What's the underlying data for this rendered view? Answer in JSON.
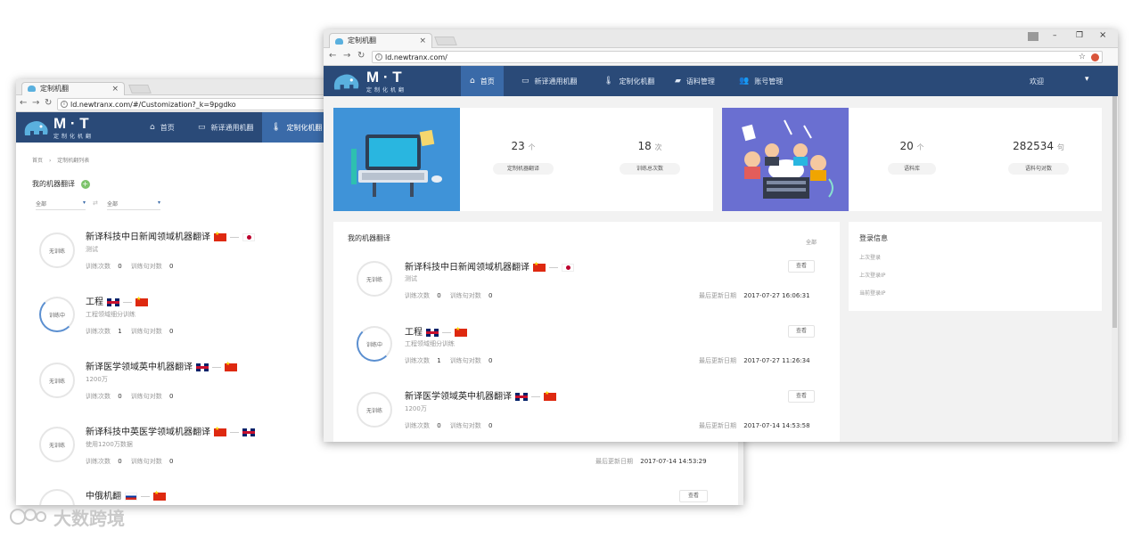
{
  "tab_title": "定制机翻",
  "back": {
    "url": "ld.newtranx.com/#/Customization?_k=9pgdko",
    "breadcrumb": [
      "首页",
      "定制机翻列表"
    ],
    "section_title": "我的机器翻译",
    "filters": [
      "全部",
      "全部"
    ],
    "items": [
      {
        "title": "新译科技中日新闻领域机器翻译",
        "desc": "测试",
        "status": "无训练",
        "train_count_label": "训练次数",
        "train_count": "0",
        "pairs_label": "训练句对数",
        "pairs": "0",
        "flags": [
          "cn",
          "jp"
        ]
      },
      {
        "title": "工程",
        "desc": "工程领域细分训练",
        "status": "训练中",
        "train_count_label": "训练次数",
        "train_count": "1",
        "pairs_label": "训练句对数",
        "pairs": "0",
        "flags": [
          "gb",
          "cn"
        ]
      },
      {
        "title": "新译医学领域英中机器翻译",
        "desc": "1200万",
        "status": "无训练",
        "train_count_label": "训练次数",
        "train_count": "0",
        "pairs_label": "训练句对数",
        "pairs": "0",
        "flags": [
          "gb",
          "cn"
        ]
      },
      {
        "title": "新译科技中英医学领域机器翻译",
        "desc": "使用1200万数据",
        "status": "无训练",
        "train_count_label": "训练次数",
        "train_count": "0",
        "pairs_label": "训练句对数",
        "pairs": "0",
        "flags": [
          "cn",
          "gb"
        ],
        "updated_label": "最后更新日期",
        "updated": "2017-07-14 14:53:29"
      },
      {
        "title": "中俄机翻",
        "flags": [
          "ru",
          "cn"
        ],
        "view": "查看"
      }
    ]
  },
  "front": {
    "url": "ld.newtranx.com/",
    "logo": "M · T",
    "logo_sub": "定制化机翻",
    "nav": [
      {
        "label": "首页",
        "icon": "home-icon",
        "glyph": "⌂"
      },
      {
        "label": "新译通用机翻",
        "icon": "laptop-icon",
        "glyph": "▭"
      },
      {
        "label": "定制化机翻",
        "icon": "thermometer-icon",
        "glyph": "🌡"
      },
      {
        "label": "语料管理",
        "icon": "folder-icon",
        "glyph": "▰"
      },
      {
        "label": "账号管理",
        "icon": "users-icon",
        "glyph": "👥"
      }
    ],
    "welcome": "欢迎",
    "stats": [
      {
        "value": "23",
        "unit": "个",
        "label": "定制机器翻译"
      },
      {
        "value": "18",
        "unit": "次",
        "label": "训练总次数"
      },
      {
        "value": "20",
        "unit": "个",
        "label": "语料库"
      },
      {
        "value": "282534",
        "unit": "句",
        "label": "语料句对数"
      }
    ],
    "section_title": "我的机器翻译",
    "all_link": "全部",
    "items": [
      {
        "title": "新译科技中日新闻领域机器翻译",
        "desc": "测试",
        "status": "无训练",
        "train_count_label": "训练次数",
        "train_count": "0",
        "pairs_label": "训练句对数",
        "pairs": "0",
        "updated_label": "最后更新日期",
        "updated": "2017-07-27 16:06:31",
        "view": "查看",
        "flags": [
          "cn",
          "jp"
        ]
      },
      {
        "title": "工程",
        "desc": "工程领域细分训练",
        "status": "训练中",
        "train_count_label": "训练次数",
        "train_count": "1",
        "pairs_label": "训练句对数",
        "pairs": "0",
        "updated_label": "最后更新日期",
        "updated": "2017-07-27 11:26:34",
        "view": "查看",
        "flags": [
          "gb",
          "cn"
        ]
      },
      {
        "title": "新译医学领域英中机器翻译",
        "desc": "1200万",
        "status": "无训练",
        "train_count_label": "训练次数",
        "train_count": "0",
        "pairs_label": "训练句对数",
        "pairs": "0",
        "updated_label": "最后更新日期",
        "updated": "2017-07-14 14:53:58",
        "view": "查看",
        "flags": [
          "gb",
          "cn"
        ]
      }
    ],
    "login": {
      "title": "登录信息",
      "rows": [
        "上次登录",
        "上次登录IP",
        "当前登录IP"
      ]
    }
  },
  "watermark": "大数跨境",
  "colors": {
    "nav": "#2a4a78",
    "nav_active": "#3a6aa8",
    "hero1": "#3f93d8",
    "hero2": "#6a6fd1"
  }
}
